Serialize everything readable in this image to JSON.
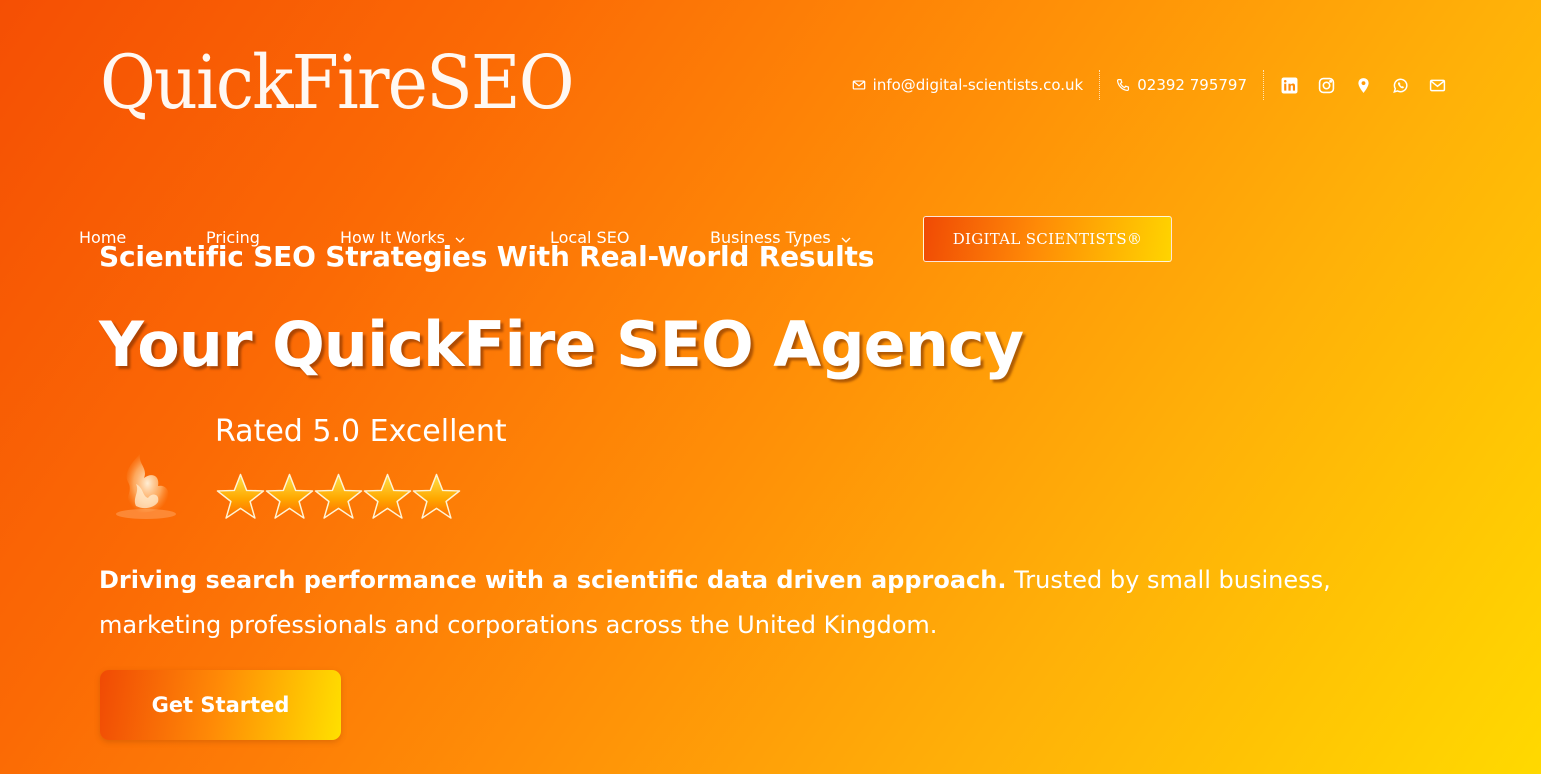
{
  "brand": {
    "logo_text": "QuickFireSEO"
  },
  "contact": {
    "email": "info@digital-scientists.co.uk",
    "phone": "02392 795797",
    "social_icons": [
      "linkedin-icon",
      "instagram-icon",
      "map-pin-icon",
      "whatsapp-icon",
      "mail-icon"
    ]
  },
  "nav": {
    "items": [
      {
        "label": "Home",
        "has_dropdown": false
      },
      {
        "label": "Pricing",
        "has_dropdown": false
      },
      {
        "label": "How It Works",
        "has_dropdown": true
      },
      {
        "label": "Local SEO",
        "has_dropdown": false
      },
      {
        "label": "Business Types",
        "has_dropdown": true
      }
    ],
    "cta_label": "DIGITAL SCIENTISTS®"
  },
  "hero": {
    "subtitle": "Scientific SEO Strategies With Real-World Results",
    "title": "Your QuickFire SEO Agency",
    "rating_label": "Rated 5.0 Excellent",
    "rating_value": 5,
    "rating_max": 5,
    "description_bold": "Driving search performance with a scientific data driven approach.",
    "description_rest": " Trusted by small business, marketing professionals and corporations across the United Kingdom.",
    "cta_label": "Get Started"
  },
  "colors": {
    "gradient_start": "#f54f04",
    "gradient_mid": "#ff8e07",
    "gradient_end": "#ffd900",
    "text": "#ffffff",
    "star_fill": "#ffa800"
  }
}
